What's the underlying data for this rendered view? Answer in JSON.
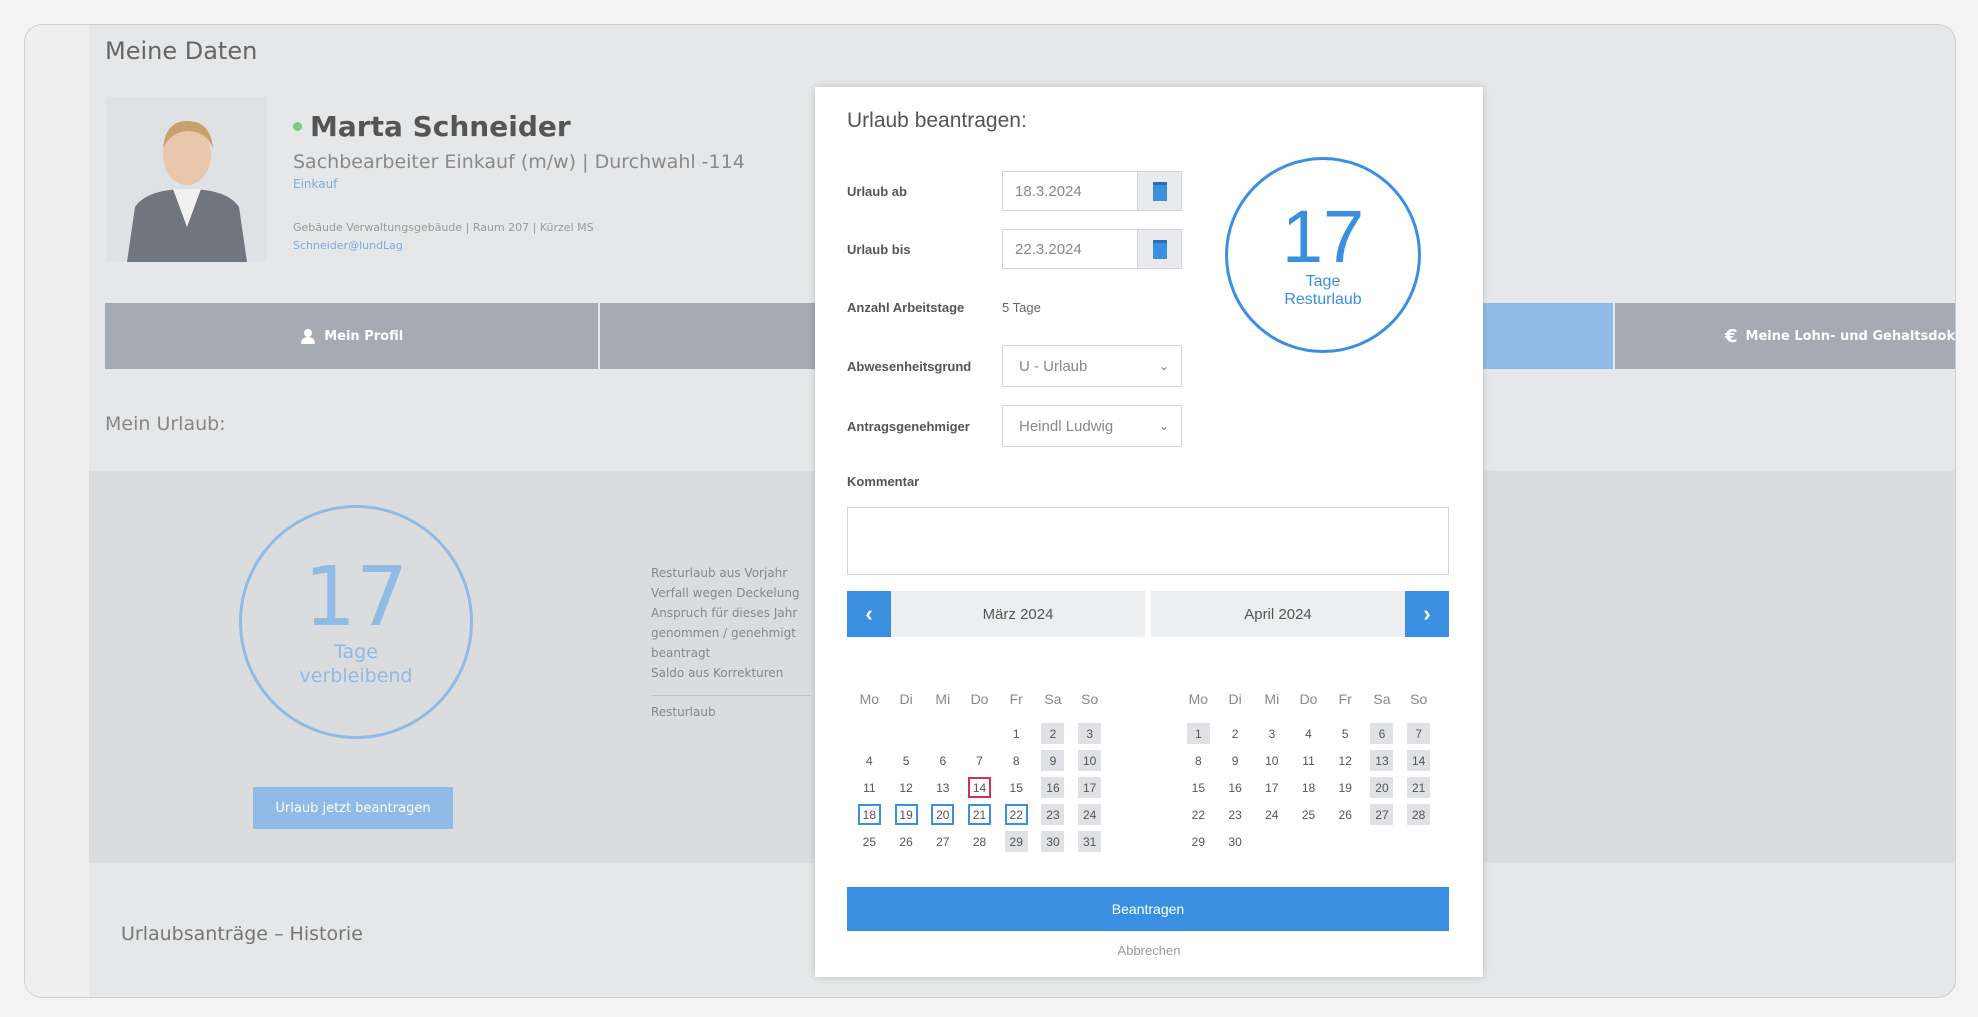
{
  "page": {
    "title": "Meine Daten"
  },
  "profile": {
    "name": "Marta Schneider",
    "role": "Sachbearbeiter Einkauf (m/w) | Durchwahl -114",
    "department": "Einkauf",
    "info": "Gebäude Verwaltungsgebäude | Raum 207 | Kürzel MS",
    "email": "Schneider@lundLag"
  },
  "nav": {
    "tab1": "Mein Profil",
    "tab5": "Meine Lohn- und Gehaltsdokumente"
  },
  "urlaub": {
    "title": "Mein Urlaub:",
    "remaining": "17",
    "remaining_label": "Tage verbleibend",
    "button": "Urlaub jetzt beantragen",
    "stats": [
      "Resturlaub aus Vorjahr",
      "Verfall wegen Deckelung",
      "Anspruch für dieses Jahr",
      "genommen / genehmigt",
      "beantragt",
      "Saldo aus Korrekturen"
    ],
    "stats_total": "Resturlaub"
  },
  "historie": "Urlaubsanträge – Historie",
  "dialog": {
    "title": "Urlaub beantragen:",
    "from_label": "Urlaub ab",
    "from_value": "18.3.2024",
    "to_label": "Urlaub bis",
    "to_value": "22.3.2024",
    "days_label": "Anzahl Arbeitstage",
    "days_value": "5 Tage",
    "reason_label": "Abwesenheitsgrund",
    "reason_value": "U - Urlaub",
    "approver_label": "Antragsgenehmiger",
    "approver_value": "Heindl Ludwig",
    "comment_label": "Kommentar",
    "rest_number": "17",
    "rest_label1": "Tage",
    "rest_label2": "Resturlaub",
    "submit": "Beantragen",
    "cancel": "Abbrechen"
  },
  "calendar": {
    "weekdays": [
      "Mo",
      "Di",
      "Mi",
      "Do",
      "Fr",
      "Sa",
      "So"
    ],
    "months": [
      {
        "label": "März 2024",
        "rows": [
          [
            null,
            null,
            null,
            null,
            "1",
            "2",
            "3"
          ],
          [
            "4",
            "5",
            "6",
            "7",
            "8",
            "9",
            "10"
          ],
          [
            "11",
            "12",
            "13",
            "14",
            "15",
            "16",
            "17"
          ],
          [
            "18",
            "19",
            "20",
            "21",
            "22",
            "23",
            "24"
          ],
          [
            "25",
            "26",
            "27",
            "28",
            "29",
            "30",
            "31"
          ]
        ],
        "weekend_days": [
          "2",
          "3",
          "9",
          "10",
          "16",
          "17",
          "23",
          "24",
          "29",
          "30",
          "31"
        ],
        "selected": [
          "18",
          "19",
          "20",
          "21",
          "22"
        ],
        "today": "14"
      },
      {
        "label": "April 2024",
        "rows": [
          [
            "1",
            "2",
            "3",
            "4",
            "5",
            "6",
            "7"
          ],
          [
            "8",
            "9",
            "10",
            "11",
            "12",
            "13",
            "14"
          ],
          [
            "15",
            "16",
            "17",
            "18",
            "19",
            "20",
            "21"
          ],
          [
            "22",
            "23",
            "24",
            "25",
            "26",
            "27",
            "28"
          ],
          [
            "29",
            "30",
            null,
            null,
            null,
            null,
            null
          ]
        ],
        "weekend_days": [
          "1",
          "6",
          "7",
          "13",
          "14",
          "20",
          "21",
          "27",
          "28"
        ],
        "selected": [],
        "today": null
      }
    ]
  },
  "colors": {
    "accent": "#3b8fe0",
    "today_border": "#d6304a",
    "nav_bg": "#a4abb2",
    "nav_active": "#8fbbe6"
  }
}
